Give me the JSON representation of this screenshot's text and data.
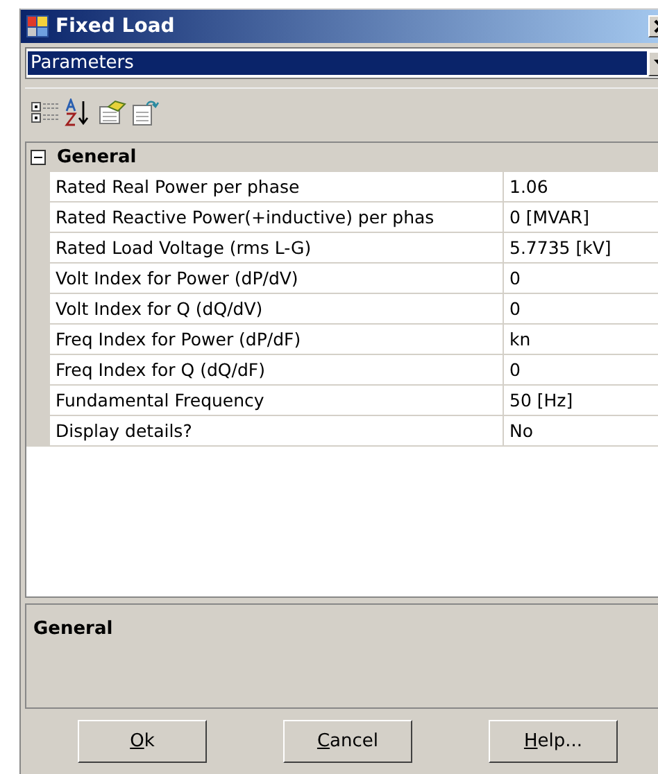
{
  "window": {
    "title": "Fixed Load"
  },
  "selector": {
    "value": "Parameters"
  },
  "category": {
    "label": "General",
    "expanded": true
  },
  "properties": [
    {
      "name": "Rated Real Power per phase",
      "value": "1.06"
    },
    {
      "name": "Rated Reactive Power(+inductive) per phas",
      "value": "0 [MVAR]"
    },
    {
      "name": "Rated Load Voltage (rms L-G)",
      "value": "5.7735 [kV]"
    },
    {
      "name": "Volt Index for Power (dP/dV)",
      "value": "0"
    },
    {
      "name": "Volt Index for Q (dQ/dV)",
      "value": "0"
    },
    {
      "name": "Freq Index for Power (dP/dF)",
      "value": "kn"
    },
    {
      "name": "Freq Index for Q (dQ/dF)",
      "value": "0"
    },
    {
      "name": "Fundamental Frequency",
      "value": "50 [Hz]"
    },
    {
      "name": "Display details?",
      "value": "No"
    }
  ],
  "description": {
    "title": "General"
  },
  "buttons": [
    "Ok",
    "Cancel",
    "Help..."
  ]
}
